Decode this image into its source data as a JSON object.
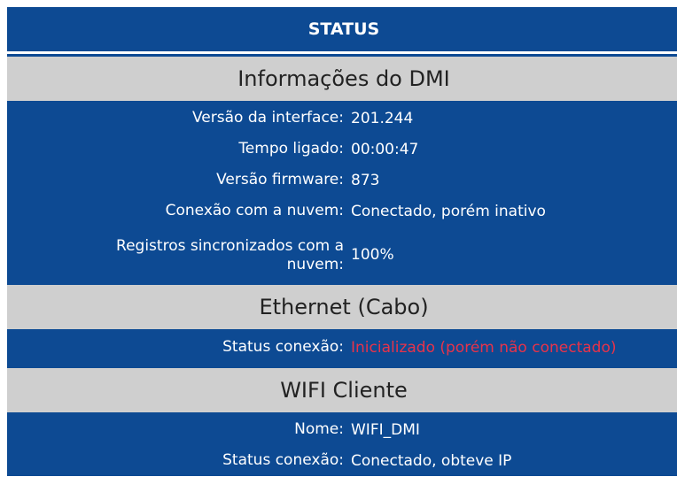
{
  "title": "STATUS",
  "sections": {
    "dmi": {
      "heading": "Informações do DMI",
      "rows": [
        {
          "label": "Versão da interface:",
          "value": "201.244"
        },
        {
          "label": "Tempo ligado:",
          "value": "00:00:47"
        },
        {
          "label": "Versão firmware:",
          "value": "873"
        },
        {
          "label": "Conexão com a nuvem:",
          "value": "Conectado, porém inativo"
        },
        {
          "label": "Registros sincronizados com a nuvem:",
          "value": "100%"
        }
      ]
    },
    "ethernet": {
      "heading": "Ethernet (Cabo)",
      "rows": [
        {
          "label": "Status conexão:",
          "value": "Inicializado (porém não conectado)"
        }
      ]
    },
    "wifi": {
      "heading": "WIFI Cliente",
      "rows": [
        {
          "label": "Nome:",
          "value": "WIFI_DMI"
        },
        {
          "label": "Status conexão:",
          "value": "Conectado, obteve IP"
        }
      ]
    }
  },
  "colors": {
    "header_bg": "#0d4a93",
    "section_bg": "#cfcfcf",
    "alert_text": "#e8334a"
  }
}
